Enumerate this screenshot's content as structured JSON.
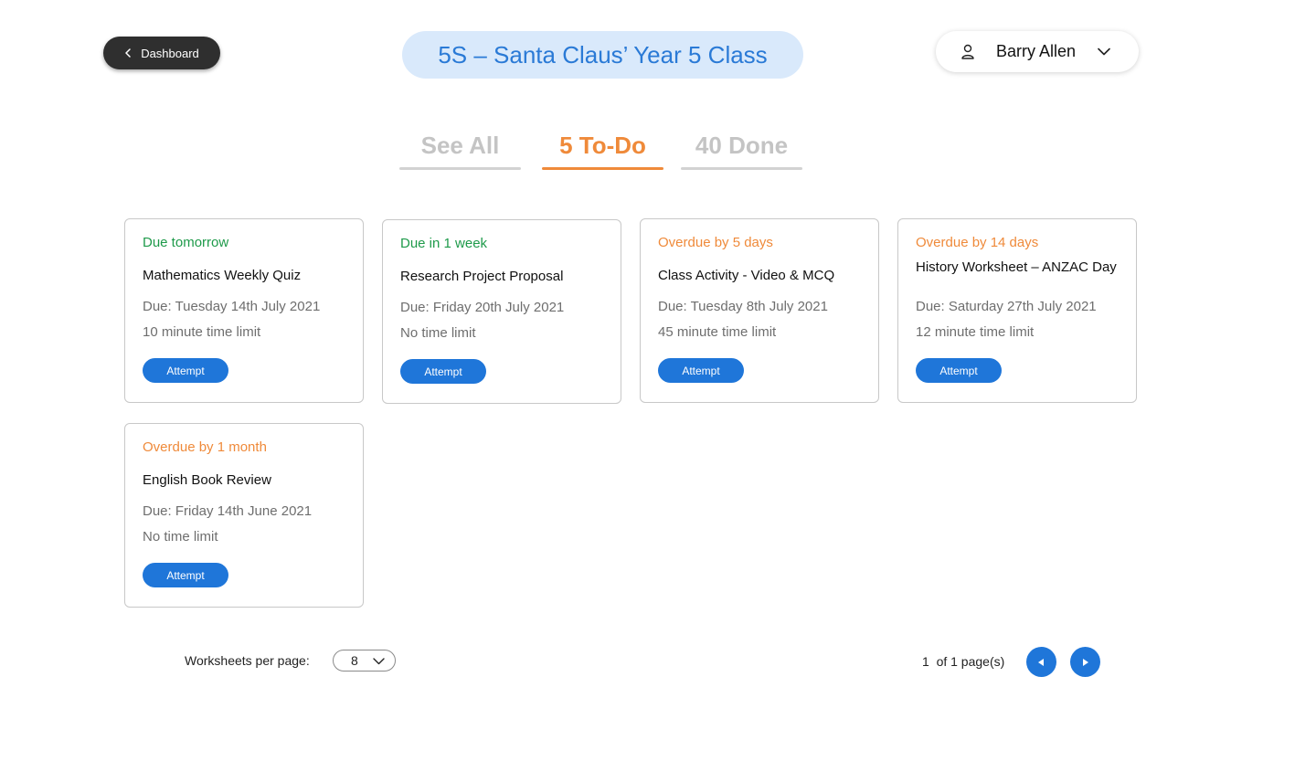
{
  "header": {
    "dashboard_label": "Dashboard",
    "class_title": "5S – Santa Claus’ Year 5 Class",
    "user_name": "Barry Allen"
  },
  "tabs": [
    {
      "label": "See All",
      "active": false
    },
    {
      "label": "5 To-Do",
      "active": true
    },
    {
      "label": "40 Done",
      "active": false
    }
  ],
  "cards": [
    {
      "status": "Due tomorrow",
      "status_kind": "ok",
      "title": "Mathematics Weekly Quiz",
      "due": "Due: Tuesday 14th July 2021",
      "limit": "10 minute time limit",
      "button": "Attempt"
    },
    {
      "status": "Due in 1 week",
      "status_kind": "ok",
      "title": "Research Project Proposal",
      "due": "Due: Friday 20th July 2021",
      "limit": "No time limit",
      "button": "Attempt"
    },
    {
      "status": "Overdue by 5 days",
      "status_kind": "late",
      "title": "Class Activity - Video & MCQ",
      "due": "Due: Tuesday 8th July 2021",
      "limit": "45 minute time limit",
      "button": "Attempt"
    },
    {
      "status": "Overdue by 14 days",
      "status_kind": "late",
      "title": "History Worksheet – ANZAC Day",
      "due": "Due: Saturday 27th July 2021",
      "limit": "12 minute time limit",
      "button": "Attempt"
    },
    {
      "status": "Overdue by 1 month",
      "status_kind": "late",
      "title": "English Book Review",
      "due": "Due: Friday 14th June 2021",
      "limit": "No time limit",
      "button": "Attempt"
    }
  ],
  "footer": {
    "per_page_label": "Worksheets per page:",
    "per_page_value": "8",
    "page_info": "1  of 1 page(s)"
  },
  "icons": {
    "back": "chevron-left-icon",
    "user": "user-icon",
    "dropdown": "chevron-down-icon",
    "prev": "caret-left-icon",
    "next": "caret-right-icon"
  },
  "colors": {
    "accent_blue": "#1f76d9",
    "title_blue": "#2a7ad6",
    "pill_bg": "#d9e9fb",
    "orange": "#ef8a3a",
    "green": "#1e9a4a",
    "dark_button": "#2f2f2f"
  }
}
